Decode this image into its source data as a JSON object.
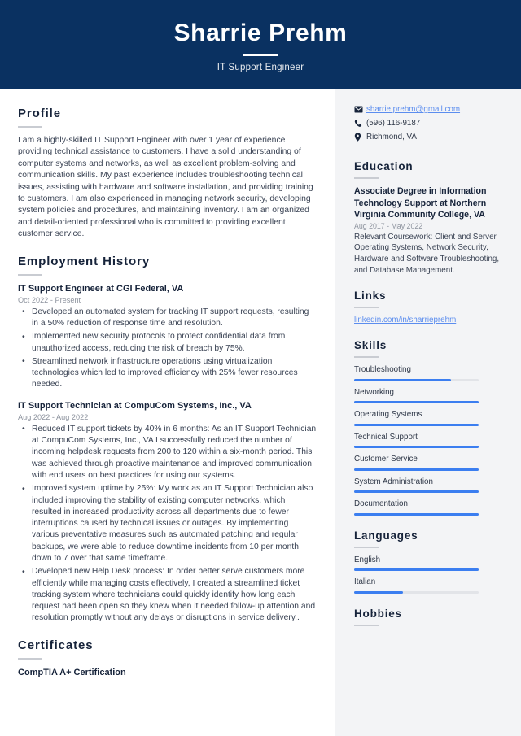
{
  "header": {
    "name": "Sharrie Prehm",
    "job_title": "IT Support Engineer",
    "background_color": "#0a3161"
  },
  "theme": {
    "accent_color": "#3b7ef0",
    "link_color": "#5b8def",
    "sidebar_background": "#f3f4f6",
    "heading_color": "#16233a"
  },
  "left": {
    "profile": {
      "heading": "Profile",
      "text": "I am a highly-skilled IT Support Engineer with over 1 year of experience providing technical assistance to customers. I have a solid understanding of computer systems and networks, as well as excellent problem-solving and communication skills. My past experience includes troubleshooting technical issues, assisting with hardware and software installation, and providing training to customers. I am also experienced in managing network security, developing system policies and procedures, and maintaining inventory. I am an organized and detail-oriented professional who is committed to providing excellent customer service."
    },
    "employment": {
      "heading": "Employment History",
      "jobs": [
        {
          "title": "IT Support Engineer at CGI Federal, VA",
          "date": "Oct 2022 - Present",
          "bullets": [
            "Developed an automated system for tracking IT support requests, resulting in a 50% reduction of response time and resolution.",
            "Implemented new security protocols to protect confidential data from unauthorized access, reducing the risk of breach by 75%.",
            "Streamlined network infrastructure operations using virtualization technologies which led to improved efficiency with 25% fewer resources needed."
          ]
        },
        {
          "title": "IT Support Technician at CompuCom Systems, Inc., VA",
          "date": "Aug 2022 - Aug 2022",
          "bullets": [
            "Reduced IT support tickets by 40% in 6 months: As an IT Support Technician at CompuCom Systems, Inc., VA I successfully reduced the number of incoming helpdesk requests from 200 to 120 within a six-month period. This was achieved through proactive maintenance and improved communication with end users on best practices for using our systems.",
            "Improved system uptime by 25%: My work as an IT Support Technician also included improving the stability of existing computer networks, which resulted in increased productivity across all departments due to fewer interruptions caused by technical issues or outages. By implementing various preventative measures such as automated patching and regular backups, we were able to reduce downtime incidents from 10 per month down to 7 over that same timeframe.",
            "Developed new Help Desk process: In order better serve customers more efficiently while managing costs effectively, I created a streamlined ticket tracking system where technicians could quickly identify how long each request had been open so they knew when it needed follow-up attention and resolution promptly without any delays or disruptions in service delivery.."
          ]
        }
      ]
    },
    "certificates": {
      "heading": "Certificates",
      "items": [
        {
          "title": "CompTIA A+ Certification"
        }
      ]
    }
  },
  "right": {
    "contact": [
      {
        "icon": "envelope-icon",
        "text": "sharrie.prehm@gmail.com",
        "is_link": true
      },
      {
        "icon": "phone-icon",
        "text": "(596) 116-9187",
        "is_link": false
      },
      {
        "icon": "location-pin-icon",
        "text": "Richmond, VA",
        "is_link": false
      }
    ],
    "education": {
      "heading": "Education",
      "items": [
        {
          "title": "Associate Degree in Information Technology Support at Northern Virginia Community College, VA",
          "date": "Aug 2017 - May 2022",
          "description": "Relevant Coursework: Client and Server Operating Systems, Network Security, Hardware and Software Troubleshooting, and Database Management."
        }
      ]
    },
    "links": {
      "heading": "Links",
      "items": [
        {
          "label": "linkedin.com/in/sharrieprehm"
        }
      ]
    },
    "skills": {
      "heading": "Skills",
      "items": [
        {
          "label": "Troubleshooting",
          "level": 78
        },
        {
          "label": "Networking",
          "level": 100
        },
        {
          "label": "Operating Systems",
          "level": 100
        },
        {
          "label": "Technical Support",
          "level": 100
        },
        {
          "label": "Customer Service",
          "level": 100
        },
        {
          "label": "System Administration",
          "level": 100
        },
        {
          "label": "Documentation",
          "level": 100
        }
      ]
    },
    "languages": {
      "heading": "Languages",
      "items": [
        {
          "label": "English",
          "level": 100
        },
        {
          "label": "Italian",
          "level": 39
        }
      ]
    },
    "hobbies": {
      "heading": "Hobbies"
    }
  }
}
